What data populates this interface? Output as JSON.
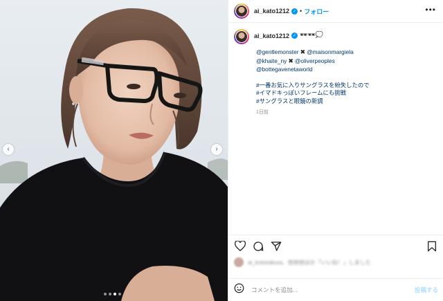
{
  "post": {
    "username": "ai_kato1212",
    "follow_label": "フォロー",
    "separator": "•",
    "more_icon": "more-horizontal-icon",
    "verified_icon": "verified-badge-icon",
    "caption_emoji": "🕶🕶💭",
    "caption_lines": [
      {
        "type": "mention_pair",
        "left": "@gentlemonster",
        "right": "@maisonmargiela"
      },
      {
        "type": "mention_pair",
        "left": "@khaite_ny",
        "right": "@oliverpeoples"
      },
      {
        "type": "mention",
        "text": "@bottegavenetaworld"
      },
      {
        "type": "gap"
      },
      {
        "type": "hashtag",
        "text": "#一番お気に入りサングラスを紛失したので"
      },
      {
        "type": "hashtag",
        "text": "#イマドキっぽいフレームにも挑戦"
      },
      {
        "type": "hashtag",
        "text": "#サングラスと眼鏡の新調"
      }
    ],
    "x_glyph": "✖",
    "time_ago": "1日前"
  },
  "carousel": {
    "prev_icon": "chevron-left-icon",
    "next_icon": "chevron-right-icon",
    "prev_glyph": "‹",
    "next_glyph": "›",
    "slide_count": 4,
    "active_index": 2
  },
  "actions": {
    "like_icon": "heart-icon",
    "comment_icon": "comment-icon",
    "share_icon": "send-icon",
    "save_icon": "bookmark-icon"
  },
  "likes": {
    "text": "ai_kotozakura、他他他ほか「いいね！」しました"
  },
  "comment": {
    "placeholder": "コメントを追加...",
    "post_label": "投稿する",
    "emoji_icon": "smiley-icon"
  },
  "colors": {
    "accent": "#0095f6",
    "link": "#00376b",
    "muted": "#8e8e8e",
    "post_disabled": "#b2dffc",
    "border": "#efefef"
  }
}
